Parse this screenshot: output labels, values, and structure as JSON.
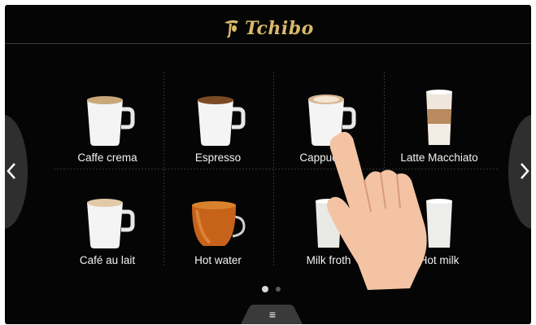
{
  "header": {
    "brand_name": "Tchibo",
    "logo_icon": "tchibo-bean-icon",
    "brand_color": "#d9b96a"
  },
  "navigation": {
    "prev_icon": "chevron-left-icon",
    "next_icon": "chevron-right-icon"
  },
  "beverages": [
    {
      "label": "Caffe crema",
      "icon": "cup-crema-icon"
    },
    {
      "label": "Espresso",
      "icon": "cup-espresso-icon"
    },
    {
      "label": "Cappuccino",
      "icon": "cup-cappuccino-icon"
    },
    {
      "label": "Latte Macchiato",
      "icon": "glass-latte-macchiato-icon"
    },
    {
      "label": "Café au lait",
      "icon": "cup-cafe-au-lait-icon"
    },
    {
      "label": "Hot water",
      "icon": "cup-hot-water-icon"
    },
    {
      "label": "Milk froth",
      "icon": "glass-milk-froth-icon"
    },
    {
      "label": "Hot milk",
      "icon": "glass-hot-milk-icon"
    }
  ],
  "pager": {
    "current_page": 1,
    "total_pages": 2
  },
  "menu": {
    "icon": "hamburger-menu-icon",
    "glyph": "≡"
  }
}
